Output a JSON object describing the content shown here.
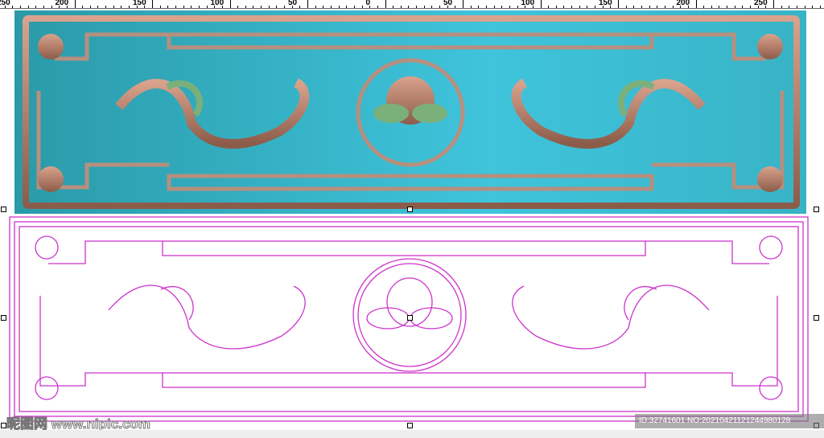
{
  "ruler": {
    "labels": [
      "250",
      "200",
      "150",
      "100",
      "50",
      "0",
      "50",
      "100",
      "150",
      "200",
      "250"
    ]
  },
  "canvas": {
    "relief_panel": {
      "name": "Relief carving preview",
      "background": "#3cb9d0",
      "relief_color": "#c98a74",
      "accent_green": "#7bb07a"
    },
    "vector_panel": {
      "name": "Vector outline",
      "line_color": "#cc33cc"
    }
  },
  "watermark": {
    "left": "昵图网 www.nipic.com",
    "right": "ID:32741601 NO:20210421121244980128"
  }
}
